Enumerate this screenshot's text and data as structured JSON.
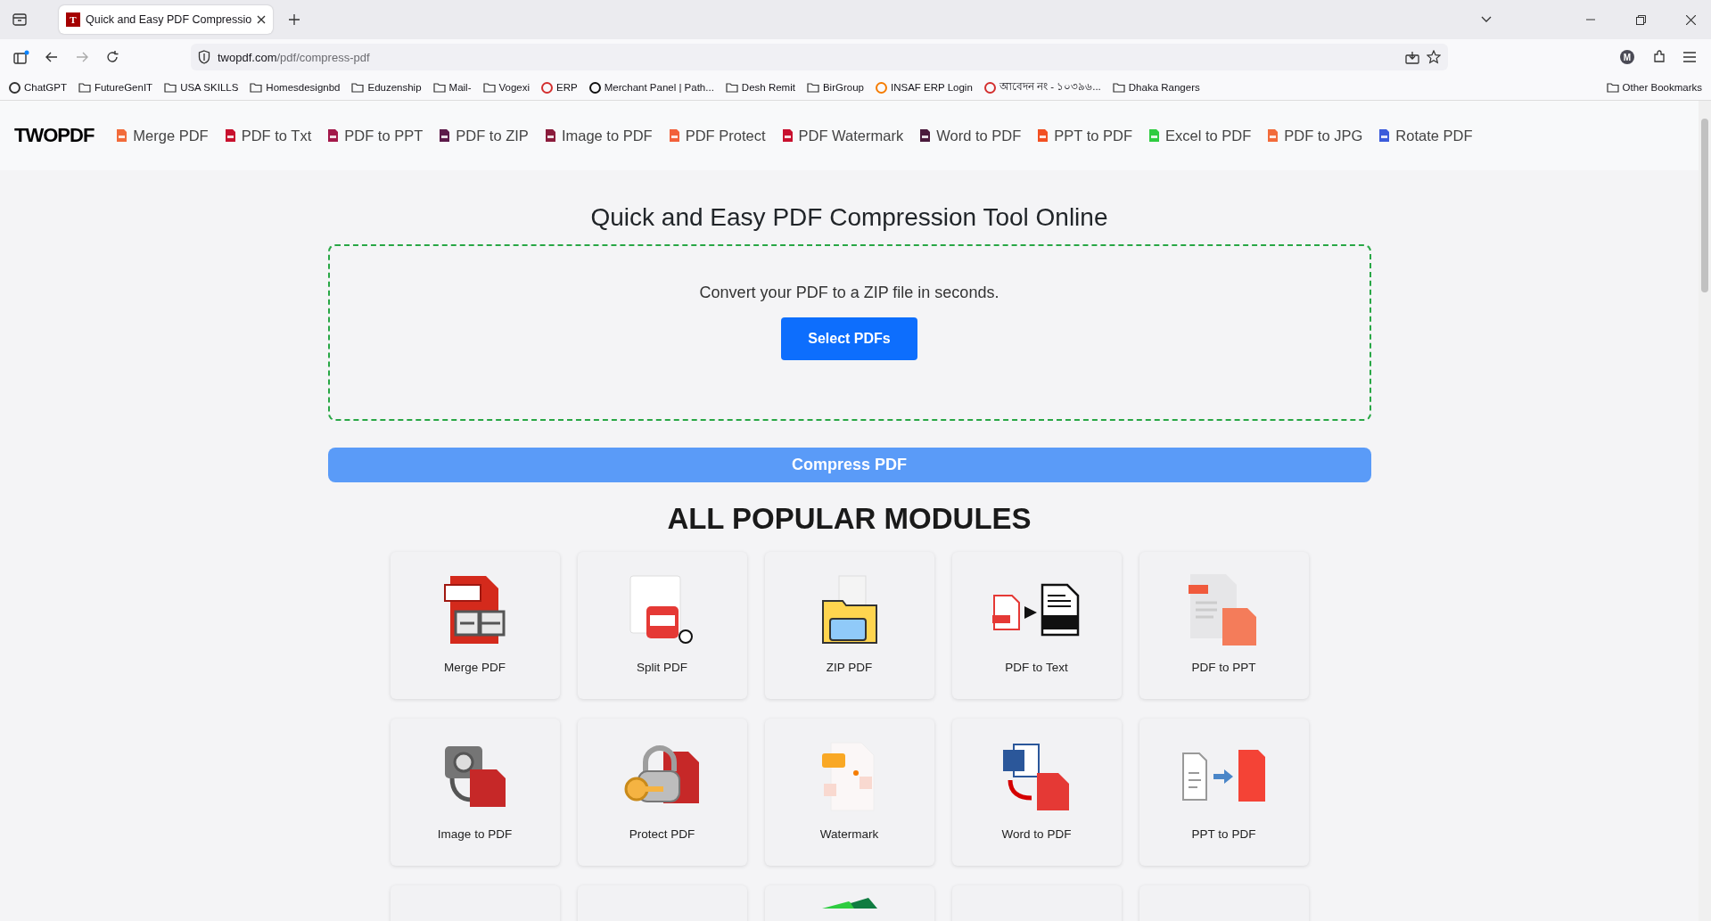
{
  "browser": {
    "tab": {
      "favicon": "T",
      "title": "Quick and Easy PDF Compressio",
      "selected": true
    },
    "url": {
      "host": "twopdf.com",
      "path": "/pdf/compress-pdf"
    },
    "bookmarks": [
      {
        "label": "ChatGPT",
        "kind": "site"
      },
      {
        "label": "FutureGenIT",
        "kind": "folder"
      },
      {
        "label": "USA SKILLS",
        "kind": "folder"
      },
      {
        "label": "Homesdesignbd",
        "kind": "folder"
      },
      {
        "label": "Eduzenship",
        "kind": "folder"
      },
      {
        "label": "Mail-",
        "kind": "folder"
      },
      {
        "label": "Vogexi",
        "kind": "folder"
      },
      {
        "label": "ERP",
        "kind": "site"
      },
      {
        "label": "Merchant Panel | Path...",
        "kind": "site"
      },
      {
        "label": "Desh Remit",
        "kind": "folder"
      },
      {
        "label": "BirGroup",
        "kind": "folder"
      },
      {
        "label": "INSAF ERP Login",
        "kind": "site"
      },
      {
        "label": "আবেদন নং - ১০৩৯৬...",
        "kind": "site"
      },
      {
        "label": "Dhaka Rangers",
        "kind": "folder"
      }
    ],
    "other_bookmarks": "Other Bookmarks",
    "profile_initial": "M"
  },
  "site": {
    "logo": "TWOPDF",
    "nav": [
      {
        "label": "Merge PDF",
        "color": "#f26b3a"
      },
      {
        "label": "PDF to Txt",
        "color": "#c8102e"
      },
      {
        "label": "PDF to PPT",
        "color": "#a3184a"
      },
      {
        "label": "PDF to ZIP",
        "color": "#5c1a4a"
      },
      {
        "label": "Image to PDF",
        "color": "#8b1c3c"
      },
      {
        "label": "PDF Protect",
        "color": "#f2603a"
      },
      {
        "label": "PDF Watermark",
        "color": "#c8102e"
      },
      {
        "label": "Word to PDF",
        "color": "#4a1a3c"
      },
      {
        "label": "PPT to PDF",
        "color": "#f25022"
      },
      {
        "label": "Excel to PDF",
        "color": "#2ecc40"
      },
      {
        "label": "PDF to JPG",
        "color": "#f26b3a"
      },
      {
        "label": "Rotate PDF",
        "color": "#3b5bdb"
      }
    ]
  },
  "heading": "Quick and Easy PDF Compression Tool Online",
  "upload": {
    "hint": "Convert your PDF to a ZIP file in seconds.",
    "button": "Select PDFs"
  },
  "action_button": "Compress PDF",
  "modules_heading": "ALL POPULAR MODULES",
  "modules": [
    {
      "label": "Merge PDF",
      "kind": "merge"
    },
    {
      "label": "Split PDF",
      "kind": "split"
    },
    {
      "label": "ZIP PDF",
      "kind": "zip"
    },
    {
      "label": "PDF to Text",
      "kind": "text"
    },
    {
      "label": "PDF to PPT",
      "kind": "ppt"
    },
    {
      "label": "Image to PDF",
      "kind": "image"
    },
    {
      "label": "Protect PDF",
      "kind": "protect"
    },
    {
      "label": "Watermark",
      "kind": "watermark"
    },
    {
      "label": "Word to PDF",
      "kind": "word"
    },
    {
      "label": "PPT to PDF",
      "kind": "pptpdf"
    },
    {
      "kind": "blank"
    },
    {
      "kind": "blank"
    },
    {
      "kind": "excel"
    },
    {
      "kind": "blank"
    },
    {
      "kind": "blank"
    }
  ]
}
